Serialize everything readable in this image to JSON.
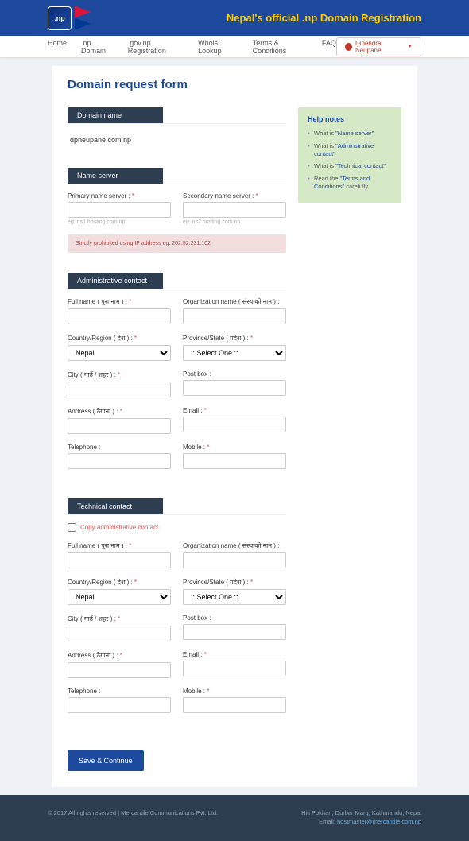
{
  "header": {
    "logo_text": ".np",
    "tagline": "Nepal's official .np Domain Registration"
  },
  "nav": {
    "items": [
      "Home",
      ".np Domain",
      ".gov.np Registration",
      "Whois Lookup",
      "Terms & Conditions",
      "FAQ"
    ],
    "user": "Dipendra Neupane"
  },
  "page": {
    "title": "Domain request form"
  },
  "sections": {
    "domain": {
      "header": "Domain name",
      "value": "dpneupane.com.np"
    },
    "nameserver": {
      "header": "Name server",
      "primary_label": "Primary name server :",
      "secondary_label": "Secondary name server :",
      "primary_hint": "eg: ns1.hosting.com.np.",
      "secondary_hint": "eg: ns2.hosting.com.np.",
      "alert": "Strictly prohibited using IP address eg: 202.52.231.102"
    },
    "admin": {
      "header": "Administrative contact"
    },
    "tech": {
      "header": "Technical contact",
      "copy_label": "Copy administrative contact"
    }
  },
  "fields": {
    "fullname": "Full name ( पुरा नाम ) :",
    "org": "Organization name ( संस्थाको नाम ) :",
    "country": "Country/Region ( देश ) :",
    "country_value": "Nepal",
    "province": "Province/State ( प्रदेश ) :",
    "province_value": ":: Select One ::",
    "city": "City ( गाउँ / शहर ) :",
    "postbox": "Post box :",
    "address": "Address ( ठेगाना ) :",
    "email": "Email :",
    "telephone": "Telephone :",
    "mobile": "Mobile :"
  },
  "help": {
    "title": "Help notes",
    "items": [
      {
        "pre": "What is ",
        "q": "\"Name server\""
      },
      {
        "pre": "What is ",
        "q": "\"Adminstrative contact\""
      },
      {
        "pre": "What is ",
        "q": "\"Technical contact\""
      },
      {
        "pre": "Read the ",
        "q": "\"Terms and Conditions\"",
        "post": " carefully"
      }
    ]
  },
  "buttons": {
    "save": "Save & Continue"
  },
  "footer": {
    "copyright": "© 2017 All rights reserved | Mercantile Communications Pvt. Ltd.",
    "address": "Hiti Pokhari, Durbar Marg, Kathmandu, Nepal",
    "email_label": "Email: ",
    "email": "hostmaster@mercantile.com.np"
  }
}
